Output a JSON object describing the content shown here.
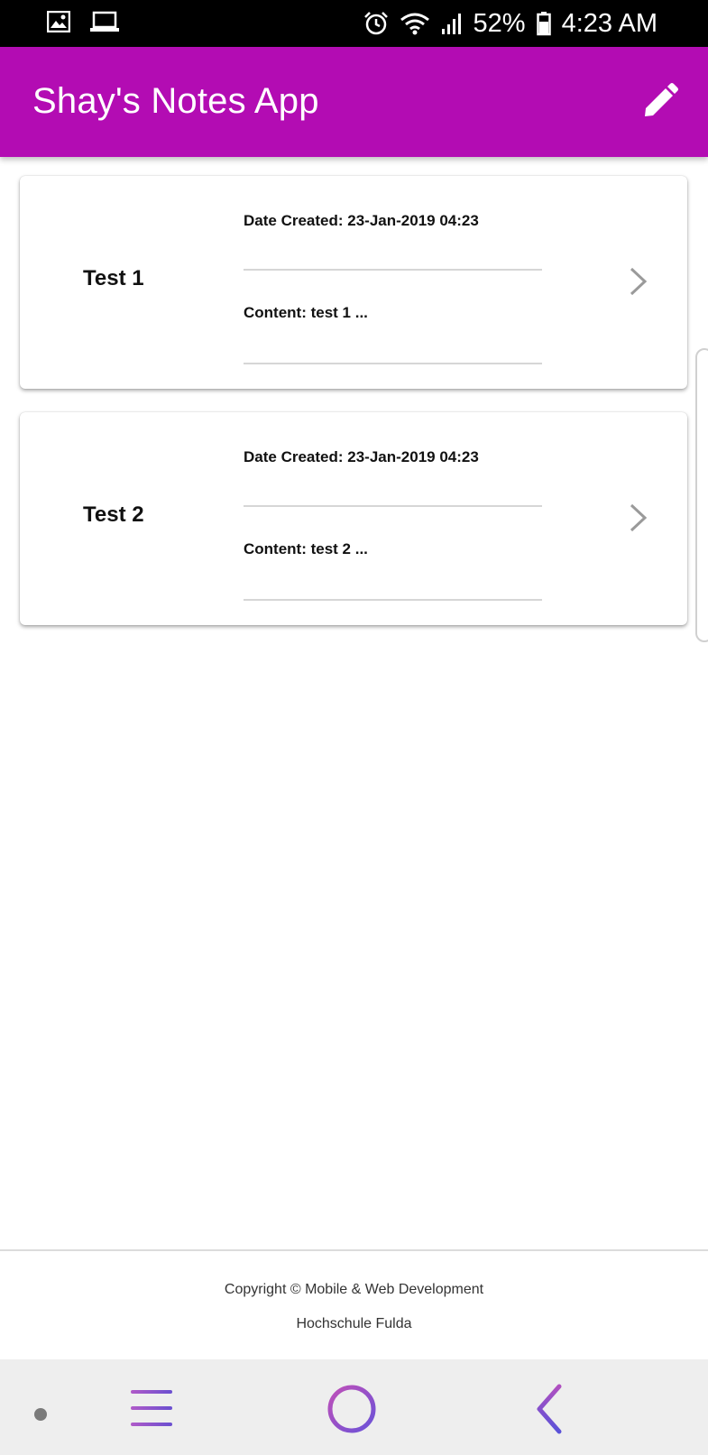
{
  "status_bar": {
    "battery": "52%",
    "time": "4:23 AM"
  },
  "app_bar": {
    "title": "Shay's Notes App"
  },
  "notes": [
    {
      "title": "Test 1",
      "date": "Date Created: 23-Jan-2019 04:23",
      "content": "Content: test 1 ..."
    },
    {
      "title": "Test 2",
      "date": "Date Created: 23-Jan-2019 04:23",
      "content": "Content: test 2 ..."
    }
  ],
  "footer": {
    "line1": "Copyright © Mobile & Web Development",
    "line2": "Hochschule Fulda"
  },
  "colors": {
    "app_bar": "#b30cb3",
    "nav_accent": "#8a4fd0"
  }
}
